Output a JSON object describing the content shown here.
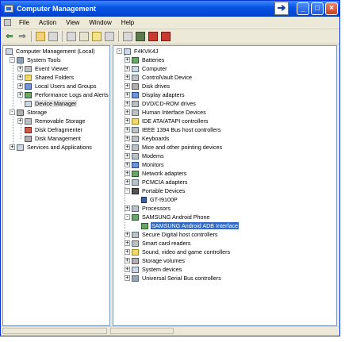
{
  "window": {
    "title": "Computer Management",
    "controls": [
      "_",
      "□",
      "×"
    ],
    "nav_arrow": "➔"
  },
  "menu": [
    "File",
    "Action",
    "View",
    "Window",
    "Help"
  ],
  "left_tree": {
    "root": "Computer Management (Local)",
    "system_tools": "System Tools",
    "system_children": [
      "Event Viewer",
      "Shared Folders",
      "Local Users and Groups",
      "Performance Logs and Alerts",
      "Device Manager"
    ],
    "storage": "Storage",
    "storage_children": [
      "Removable Storage",
      "Disk Defragmenter",
      "Disk Management"
    ],
    "services": "Services and Applications"
  },
  "right_tree": {
    "root": "F4KVK4J",
    "items": [
      "Batteries",
      "Computer",
      "ControlVault Device",
      "Disk drives",
      "Display adapters",
      "DVD/CD-ROM drives",
      "Human Interface Devices",
      "IDE ATA/ATAPI controllers",
      "IEEE 1394 Bus host controllers",
      "Keyboards",
      "Mice and other pointing devices",
      "Modems",
      "Monitors",
      "Network adapters",
      "PCMCIA adapters",
      "Portable Devices",
      "GT-I9100P",
      "Processors",
      "SAMSUNG Android Phone",
      "SAMSUNG Android ADB Interface",
      "Secure Digital host controllers",
      "Smart card readers",
      "Sound, video and game controllers",
      "Storage volumes",
      "System devices",
      "Universal Serial Bus controllers"
    ]
  }
}
